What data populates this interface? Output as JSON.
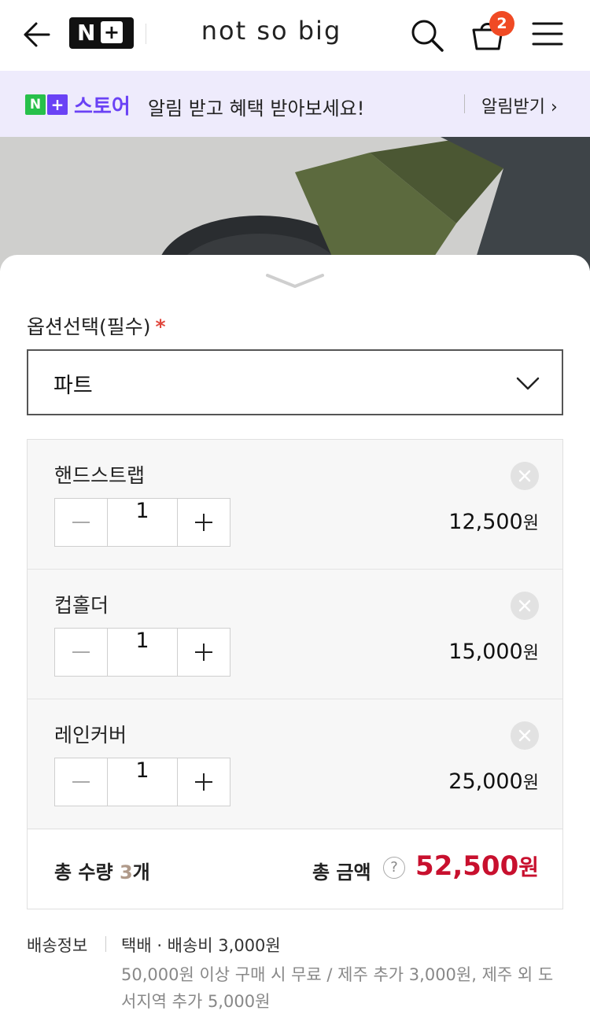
{
  "header": {
    "brand_badge": "N",
    "brand_badge_plus": "+",
    "store_name": "not so big",
    "cart_count": "2",
    "icons": [
      "back-arrow-icon",
      "search-icon",
      "cart-icon",
      "menu-icon"
    ]
  },
  "banner": {
    "logo_n": "N",
    "logo_plus": "+",
    "logo_text": "스토어",
    "message": "알림 받고 혜택 받아보세요!",
    "action": "알림받기 ›"
  },
  "sheet": {
    "option_label": "옵션선택(필수)",
    "required_mark": "*",
    "selected_option": "파트",
    "items": [
      {
        "name": "핸드스트랩",
        "qty": "1",
        "price": "12,500",
        "unit": "원"
      },
      {
        "name": "컵홀더",
        "qty": "1",
        "price": "15,000",
        "unit": "원"
      },
      {
        "name": "레인커버",
        "qty": "1",
        "price": "25,000",
        "unit": "원"
      }
    ],
    "total_qty_label": "총 수량 ",
    "total_qty": "3",
    "total_qty_unit": "개",
    "total_amount_label": "총 금액",
    "help_mark": "?",
    "total_amount": "52,500",
    "total_amount_unit": "원"
  },
  "shipping": {
    "label": "배송정보",
    "main": "택배 · 배송비 3,000원",
    "sub": "50,000원 이상 구매 시 무료 / 제주 추가 3,000원, 제주 외 도서지역 추가 5,000원"
  },
  "colors": {
    "accent_price": "#c8102e",
    "banner_bg": "#eeebfc",
    "store_purple": "#6a42f5",
    "store_green": "#27c04a",
    "badge": "#f04a24"
  }
}
